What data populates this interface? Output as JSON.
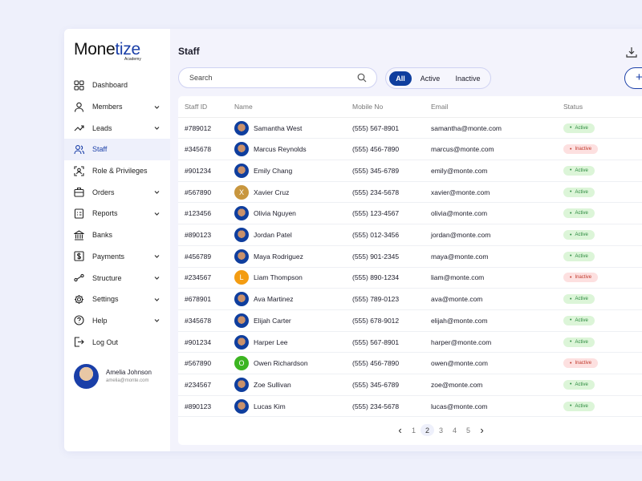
{
  "brand": {
    "name_a": "Mone",
    "name_b": "tize",
    "sub": "Academy",
    "accent": "#1a3fa8"
  },
  "sidebar": {
    "items": [
      {
        "label": "Dashboard",
        "icon": "grid-icon",
        "chevron": false
      },
      {
        "label": "Members",
        "icon": "user-icon",
        "chevron": true
      },
      {
        "label": "Leads",
        "icon": "trending-up-icon",
        "chevron": true
      },
      {
        "label": "Staff",
        "icon": "users-icon",
        "chevron": false,
        "active": true
      },
      {
        "label": "Role & Privileges",
        "icon": "id-scan-icon",
        "chevron": false
      },
      {
        "label": "Orders",
        "icon": "briefcase-icon",
        "chevron": true
      },
      {
        "label": "Reports",
        "icon": "report-icon",
        "chevron": true
      },
      {
        "label": "Banks",
        "icon": "bank-icon",
        "chevron": false
      },
      {
        "label": "Payments",
        "icon": "dollar-icon",
        "chevron": true
      },
      {
        "label": "Structure",
        "icon": "structure-icon",
        "chevron": true
      },
      {
        "label": "Settings",
        "icon": "gear-icon",
        "chevron": true
      },
      {
        "label": "Help",
        "icon": "help-icon",
        "chevron": true
      },
      {
        "label": "Log Out",
        "icon": "logout-icon",
        "chevron": false
      }
    ]
  },
  "user": {
    "name": "Amelia Johnson",
    "email": "amelia@monte.com"
  },
  "header": {
    "title": "Staff",
    "add_label": "+"
  },
  "search": {
    "placeholder": "Search"
  },
  "filters": [
    {
      "label": "All",
      "selected": true
    },
    {
      "label": "Active"
    },
    {
      "label": "Inactive"
    }
  ],
  "table": {
    "columns": [
      "Staff ID",
      "Name",
      "Mobile No",
      "Email",
      "Status"
    ],
    "rows": [
      {
        "id": "#789012",
        "name": "Samantha West",
        "mobile": "(555) 567-8901",
        "email": "samantha@monte.com",
        "status": "Active"
      },
      {
        "id": "#345678",
        "name": "Marcus Reynolds",
        "mobile": "(555) 456-7890",
        "email": "marcus@monte.com",
        "status": "Inactive"
      },
      {
        "id": "#901234",
        "name": "Emily Chang",
        "mobile": "(555) 345-6789",
        "email": "emily@monte.com",
        "status": "Active"
      },
      {
        "id": "#567890",
        "name": "Xavier Cruz",
        "mobile": "(555) 234-5678",
        "email": "xavier@monte.com",
        "status": "Active",
        "initial": "X",
        "color": "#c8963e"
      },
      {
        "id": "#123456",
        "name": "Olivia Nguyen",
        "mobile": "(555) 123-4567",
        "email": "olivia@monte.com",
        "status": "Active"
      },
      {
        "id": "#890123",
        "name": "Jordan Patel",
        "mobile": "(555) 012-3456",
        "email": "jordan@monte.com",
        "status": "Active"
      },
      {
        "id": "#456789",
        "name": "Maya Rodriguez",
        "mobile": "(555) 901-2345",
        "email": "maya@monte.com",
        "status": "Active"
      },
      {
        "id": "#234567",
        "name": "Liam Thompson",
        "mobile": "(555) 890-1234",
        "email": "liam@monte.com",
        "status": "Inactive",
        "initial": "L",
        "color": "#f39c12"
      },
      {
        "id": "#678901",
        "name": "Ava Martinez",
        "mobile": "(555) 789-0123",
        "email": "ava@monte.com",
        "status": "Active"
      },
      {
        "id": "#345678",
        "name": "Elijah Carter",
        "mobile": "(555) 678-9012",
        "email": "elijah@monte.com",
        "status": "Active"
      },
      {
        "id": "#901234",
        "name": "Harper Lee",
        "mobile": "(555) 567-8901",
        "email": "harper@monte.com",
        "status": "Active"
      },
      {
        "id": "#567890",
        "name": "Owen Richardson",
        "mobile": "(555) 456-7890",
        "email": "owen@monte.com",
        "status": "Inactive",
        "initial": "O",
        "color": "#3cb521"
      },
      {
        "id": "#234567",
        "name": "Zoe Sullivan",
        "mobile": "(555) 345-6789",
        "email": "zoe@monte.com",
        "status": "Active"
      },
      {
        "id": "#890123",
        "name": "Lucas Kim",
        "mobile": "(555) 234-5678",
        "email": "lucas@monte.com",
        "status": "Active"
      }
    ]
  },
  "pagination": {
    "pages": [
      "1",
      "2",
      "3",
      "4",
      "5"
    ],
    "current": "2",
    "prev": "‹",
    "next": "›"
  }
}
